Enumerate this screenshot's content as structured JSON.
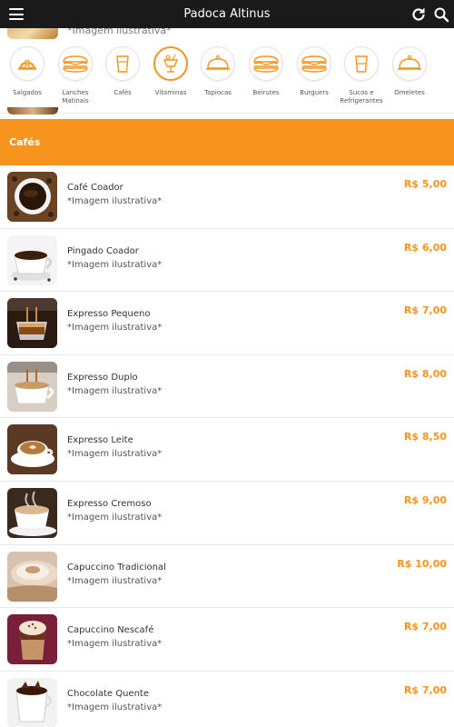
{
  "header": {
    "title": "Padoca Altinus",
    "menu_icon": "hamburger-menu-icon",
    "refresh_icon": "refresh-icon",
    "search_icon": "search-icon",
    "background": "#1a1a1a"
  },
  "peek": {
    "note": "*Imagem ilustrativa*"
  },
  "categories": [
    {
      "label": "Salgados",
      "icon": "salgados-icon"
    },
    {
      "label": "Lanches Matinais",
      "icon": "sandwich-icon"
    },
    {
      "label": "Cafés",
      "icon": "cup-icon"
    },
    {
      "label": "Vitaminas",
      "icon": "smoothie-icon",
      "active": true
    },
    {
      "label": "Tapiocas",
      "icon": "cloche-icon"
    },
    {
      "label": "Beirutes",
      "icon": "sandwich-icon"
    },
    {
      "label": "Burguers",
      "icon": "sandwich-icon"
    },
    {
      "label": "Sucos e Refrigerantes",
      "icon": "juice-cup-icon"
    },
    {
      "label": "Omeletes",
      "icon": "cloche-icon"
    }
  ],
  "section": {
    "title": "Cafés",
    "accent": "#f7941d"
  },
  "items": [
    {
      "name": "Café Coador",
      "note": "*Imagem ilustrativa*",
      "price": "R$ 5,00"
    },
    {
      "name": "Pingado Coador",
      "note": "*Imagem ilustrativa*",
      "price": "R$ 6,00"
    },
    {
      "name": "Expresso Pequeno",
      "note": "*Imagem ilustrativa*",
      "price": "R$ 7,00"
    },
    {
      "name": "Expresso Duplo",
      "note": "*Imagem ilustrativa*",
      "price": "R$ 8,00"
    },
    {
      "name": "Expresso Leite",
      "note": "*Imagem ilustrativa*",
      "price": "R$ 8,50"
    },
    {
      "name": "Expresso Cremoso",
      "note": "*Imagem ilustrativa*",
      "price": "R$ 9,00"
    },
    {
      "name": "Capuccino Tradicional",
      "note": "*Imagem ilustrativa*",
      "price": "R$ 10,00"
    },
    {
      "name": "Capuccino Nescafé",
      "note": "*Imagem ilustrativa*",
      "price": "R$ 7,00"
    },
    {
      "name": "Chocolate Quente",
      "note": "*Imagem ilustrativa*",
      "price": "R$ 7,00"
    }
  ]
}
